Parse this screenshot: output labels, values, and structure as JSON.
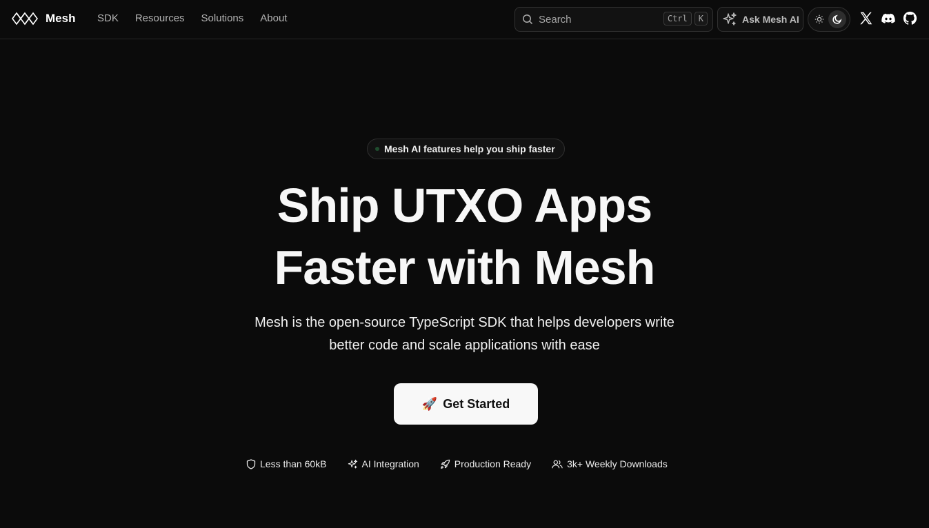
{
  "header": {
    "brand": "Mesh",
    "nav": [
      "SDK",
      "Resources",
      "Solutions",
      "About"
    ],
    "search": {
      "placeholder": "Search",
      "shortcut": [
        "Ctrl",
        "K"
      ]
    },
    "ask_ai": "Ask Mesh AI",
    "theme": {
      "mode": "dark"
    },
    "social": [
      "x-icon",
      "discord-icon",
      "github-icon"
    ]
  },
  "hero": {
    "announcement": "Mesh AI features help you ship faster",
    "headline": [
      "Ship UTXO Apps",
      "Faster with Mesh"
    ],
    "subheadline": [
      "Mesh is the open-source TypeScript SDK that helps developers write",
      "better code and scale applications with ease"
    ],
    "cta": {
      "icon": "🚀",
      "label": "Get Started"
    },
    "features": [
      {
        "icon": "shield-icon",
        "label": "Less than 60kB"
      },
      {
        "icon": "sparkles-icon",
        "label": "AI Integration"
      },
      {
        "icon": "rocket-icon",
        "label": "Production Ready"
      },
      {
        "icon": "users-icon",
        "label": "3k+ Weekly Downloads"
      }
    ]
  },
  "colors": {
    "background": "#0b0b0b",
    "border": "#262626",
    "text": "#f2f2f2",
    "muted": "#b3b3b3",
    "cta_bg": "#f8f8f8"
  }
}
